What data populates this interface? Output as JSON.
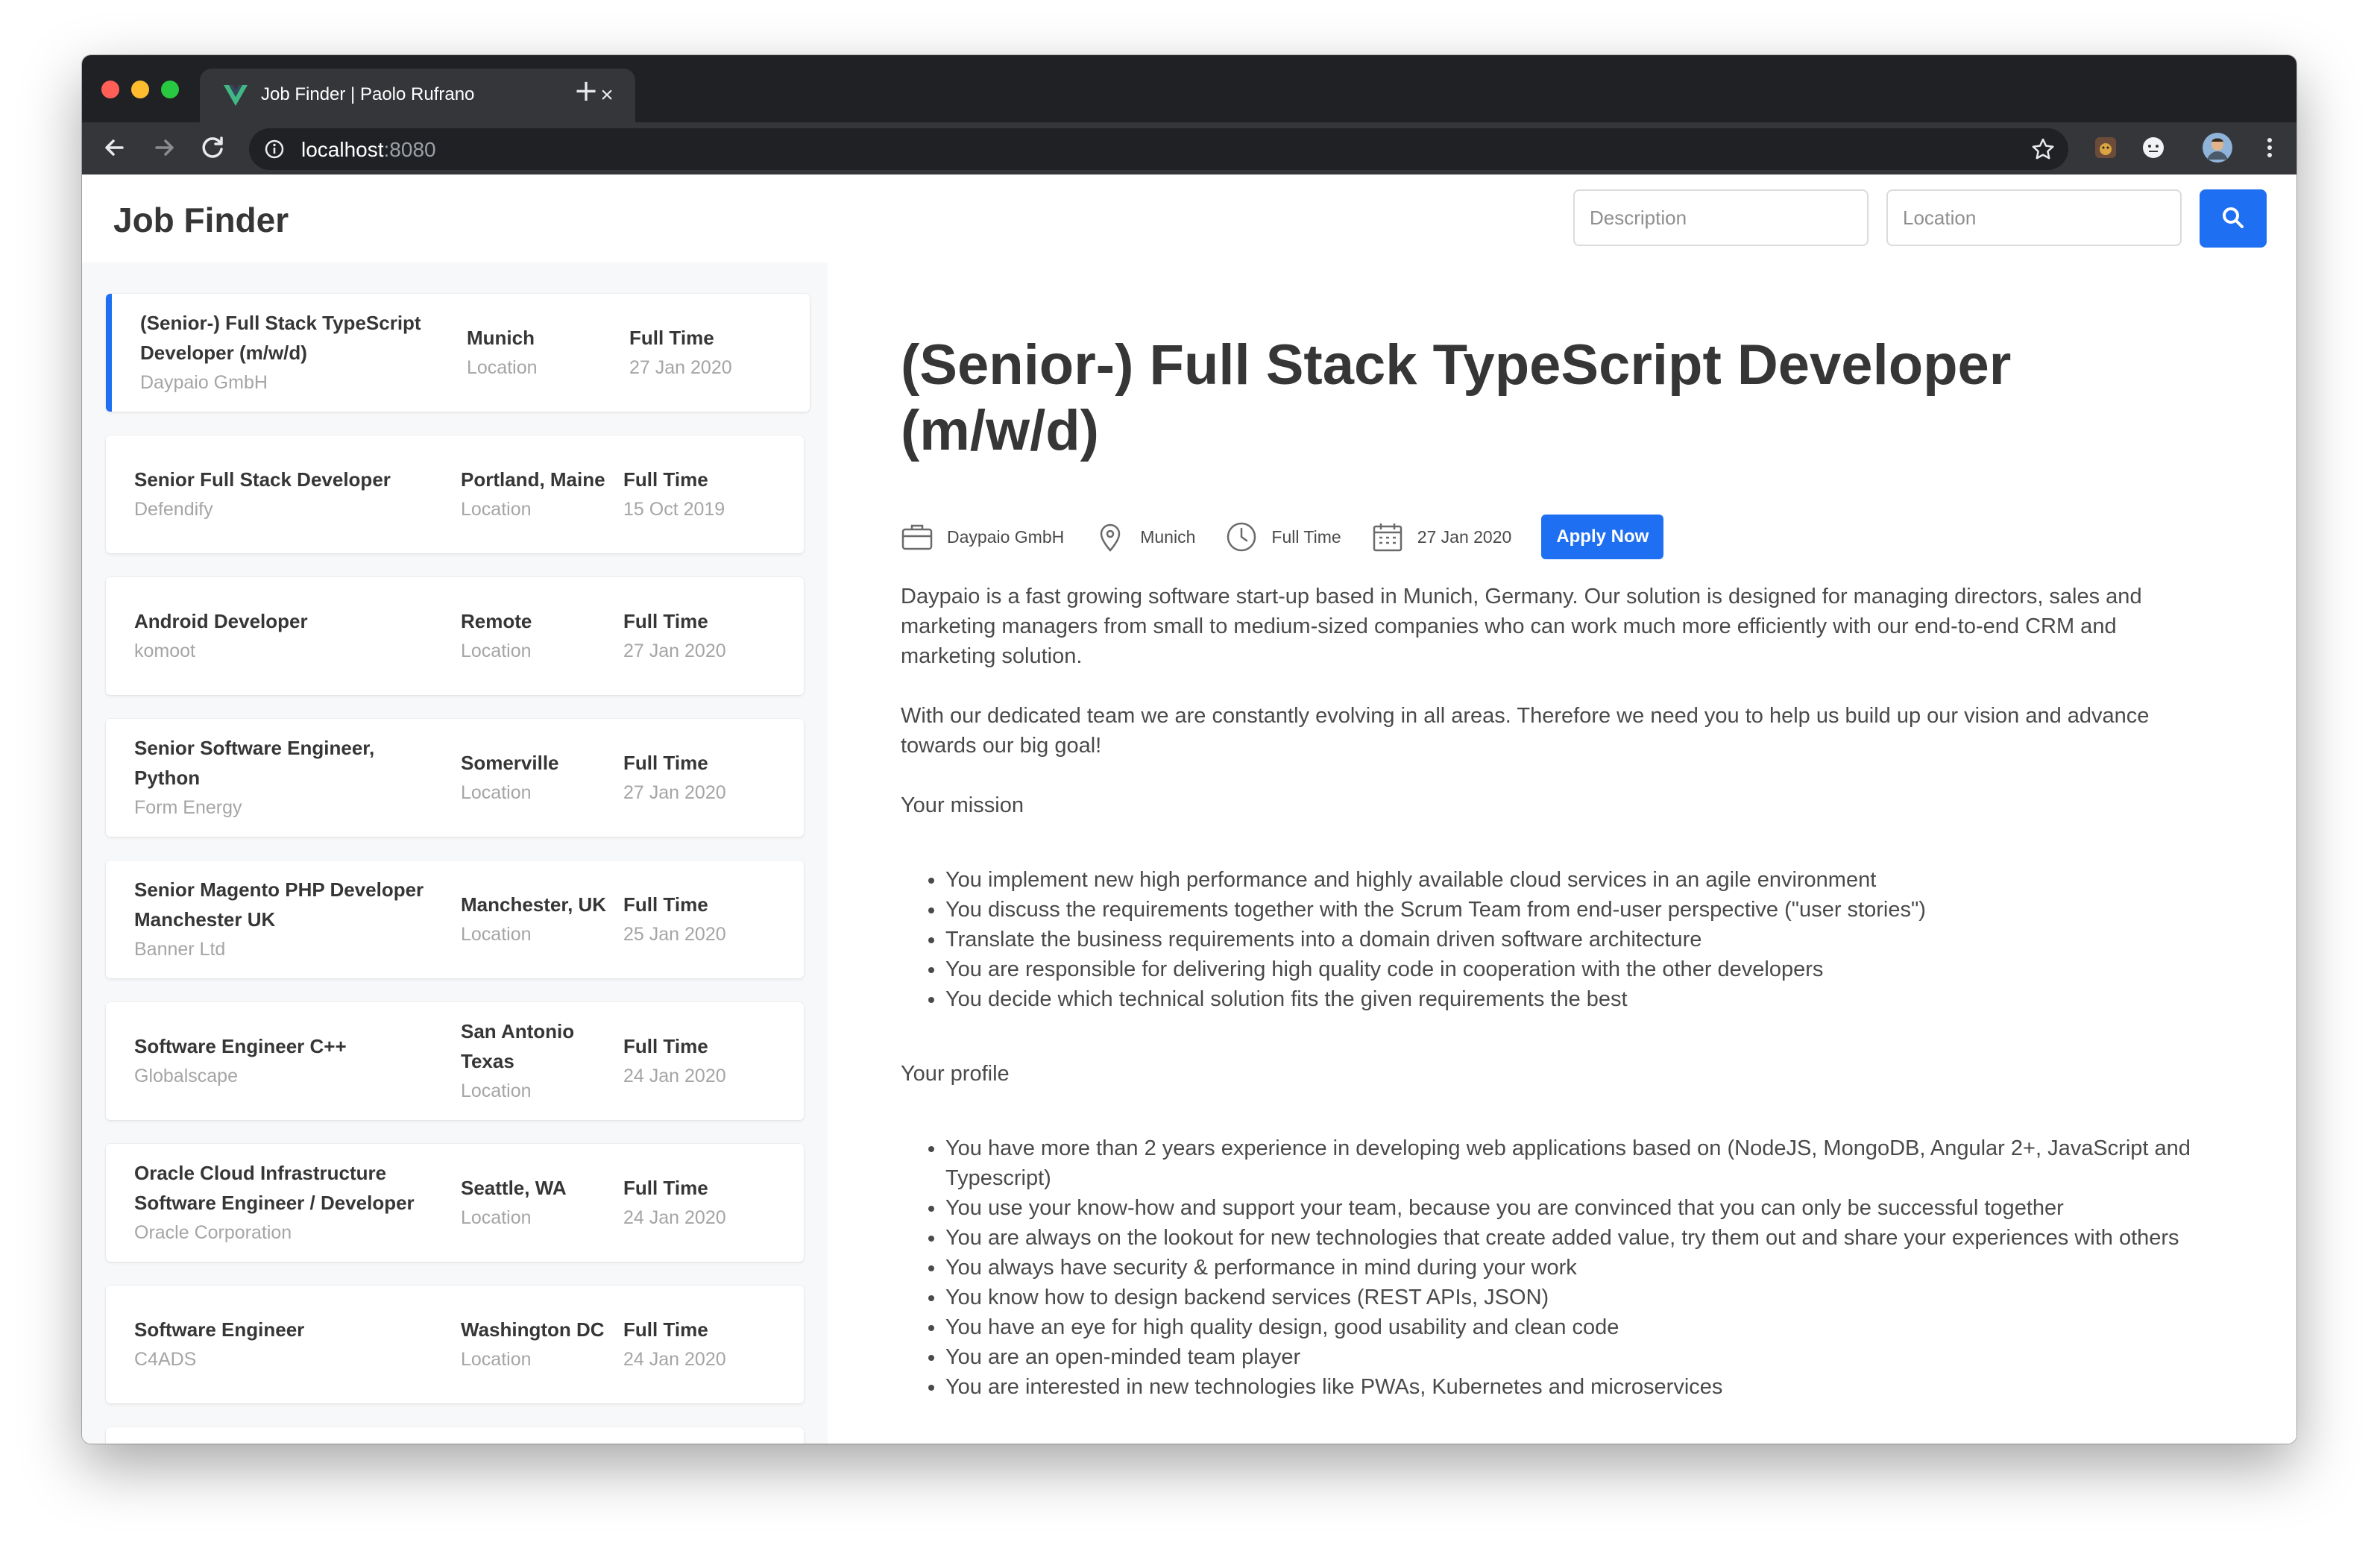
{
  "browser": {
    "tab_title": "Job Finder | Paolo Rufrano",
    "url_host": "localhost",
    "url_port": ":8080"
  },
  "app": {
    "brand": "Job Finder",
    "search": {
      "description_placeholder": "Description",
      "location_placeholder": "Location"
    }
  },
  "jobs": [
    {
      "title": "(Senior-) Full Stack TypeScript Developer (m/w/d)",
      "company": "Daypaio GmbH",
      "location": "Munich",
      "location_label": "Location",
      "type": "Full Time",
      "date": "27 Jan 2020"
    },
    {
      "title": "Senior Full Stack Developer",
      "company": "Defendify",
      "location": "Portland, Maine",
      "location_label": "Location",
      "type": "Full Time",
      "date": "15 Oct 2019"
    },
    {
      "title": "Android Developer",
      "company": "komoot",
      "location": "Remote",
      "location_label": "Location",
      "type": "Full Time",
      "date": "27 Jan 2020"
    },
    {
      "title": "Senior Software Engineer, Python",
      "company": "Form Energy",
      "location": "Somerville",
      "location_label": "Location",
      "type": "Full Time",
      "date": "27 Jan 2020"
    },
    {
      "title": "Senior Magento PHP Developer Manchester UK",
      "company": "Banner Ltd",
      "location": "Manchester, UK",
      "location_label": "Location",
      "type": "Full Time",
      "date": "25 Jan 2020"
    },
    {
      "title": "Software Engineer C++",
      "company": "Globalscape",
      "location": "San Antonio Texas",
      "location_label": "Location",
      "type": "Full Time",
      "date": "24 Jan 2020"
    },
    {
      "title": "Oracle Cloud Infrastructure Software Engineer / Developer",
      "company": "Oracle Corporation",
      "location": "Seattle, WA",
      "location_label": "Location",
      "type": "Full Time",
      "date": "24 Jan 2020"
    },
    {
      "title": "Software Engineer",
      "company": "C4ADS",
      "location": "Washington DC",
      "location_label": "Location",
      "type": "Full Time",
      "date": "24 Jan 2020"
    }
  ],
  "detail": {
    "title": "(Senior-) Full Stack TypeScript Developer (m/w/d)",
    "company": "Daypaio GmbH",
    "location": "Munich",
    "type": "Full Time",
    "date": "27 Jan 2020",
    "apply_label": "Apply Now",
    "intro_1": "Daypaio is a fast growing software start-up based in Munich, Germany. Our solution is designed for managing directors, sales and marketing managers from small to medium-sized companies who can work much more efficiently with our end-to-end CRM and marketing solution.",
    "intro_2": "With our dedicated team we are constantly evolving in all areas. Therefore we need you to help us build up our vision and advance towards our big goal!",
    "mission_heading": "Your mission",
    "mission": [
      "You implement new high performance and highly available cloud services in an agile environment",
      "You discuss the requirements together with the Scrum Team from end-user perspective (\"user stories\")",
      "Translate the business requirements into a domain driven software architecture",
      "You are responsible for delivering high quality code in cooperation with the other developers",
      "You decide which technical solution fits the given requirements the best"
    ],
    "profile_heading": "Your profile",
    "profile": [
      "You have more than 2 years experience in developing web applications based on (NodeJS, MongoDB, Angular 2+, JavaScript and Typescript)",
      "You use your know-how and support your team, because you are convinced that you can only be successful together",
      "You are always on the lookout for new technologies that create added value, try them out and share your experiences with others",
      "You always have security & performance in mind during your work",
      "You know how to design backend services (REST APIs, JSON)",
      "You have an eye for high quality design, good usability and clean code",
      "You are an open-minded team player",
      "You are interested in new technologies like PWAs, Kubernetes and microservices"
    ]
  },
  "colors": {
    "accent": "#1f6ff2",
    "text": "#363636",
    "muted": "#a5a5a5"
  }
}
